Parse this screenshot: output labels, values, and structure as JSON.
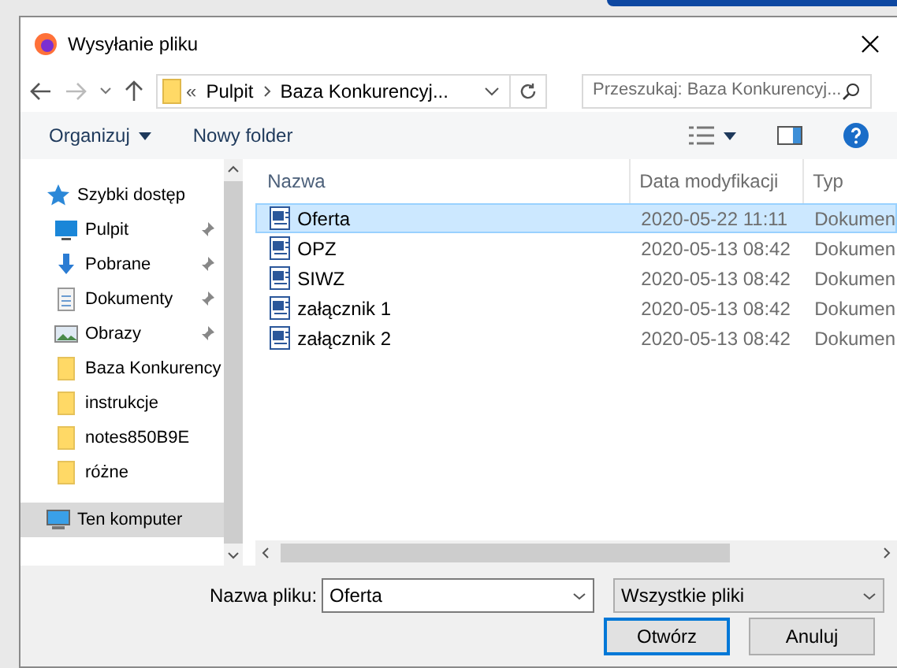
{
  "window": {
    "title": "Wysyłanie pliku"
  },
  "address": {
    "overflow": "«",
    "crumbs": [
      "Pulpit",
      "Baza Konkurencyj..."
    ]
  },
  "search": {
    "placeholder": "Przeszukaj: Baza Konkurencyj..."
  },
  "toolbar": {
    "organize": "Organizuj",
    "new_folder": "Nowy folder"
  },
  "sidebar": {
    "items": [
      {
        "kind": "quick",
        "label": "Szybki dostęp",
        "pinned": false,
        "selected": false
      },
      {
        "kind": "desktop",
        "label": "Pulpit",
        "pinned": true,
        "selected": false
      },
      {
        "kind": "downloads",
        "label": "Pobrane",
        "pinned": true,
        "selected": false
      },
      {
        "kind": "documents",
        "label": "Dokumenty",
        "pinned": true,
        "selected": false
      },
      {
        "kind": "pictures",
        "label": "Obrazy",
        "pinned": true,
        "selected": false
      },
      {
        "kind": "folder",
        "label": "Baza Konkurency",
        "pinned": false,
        "selected": false
      },
      {
        "kind": "folder",
        "label": "instrukcje",
        "pinned": false,
        "selected": false
      },
      {
        "kind": "folder",
        "label": "notes850B9E",
        "pinned": false,
        "selected": false
      },
      {
        "kind": "folder",
        "label": "różne",
        "pinned": false,
        "selected": false
      },
      {
        "kind": "computer",
        "label": "Ten komputer",
        "pinned": false,
        "selected": true
      }
    ]
  },
  "table": {
    "columns": [
      "Nazwa",
      "Data modyfikacji",
      "Typ"
    ],
    "rows": [
      {
        "name": "Oferta",
        "date": "2020-05-22 11:11",
        "type": "Dokumen",
        "selected": true
      },
      {
        "name": "OPZ",
        "date": "2020-05-13 08:42",
        "type": "Dokumen",
        "selected": false
      },
      {
        "name": "SIWZ",
        "date": "2020-05-13 08:42",
        "type": "Dokumen",
        "selected": false
      },
      {
        "name": "załącznik 1",
        "date": "2020-05-13 08:42",
        "type": "Dokumen",
        "selected": false
      },
      {
        "name": "załącznik 2",
        "date": "2020-05-13 08:42",
        "type": "Dokumen",
        "selected": false
      }
    ]
  },
  "footer": {
    "filename_label": "Nazwa pliku:",
    "filename": "Oferta",
    "filter": "Wszystkie pliki",
    "open": "Otwórz",
    "cancel": "Anuluj"
  }
}
